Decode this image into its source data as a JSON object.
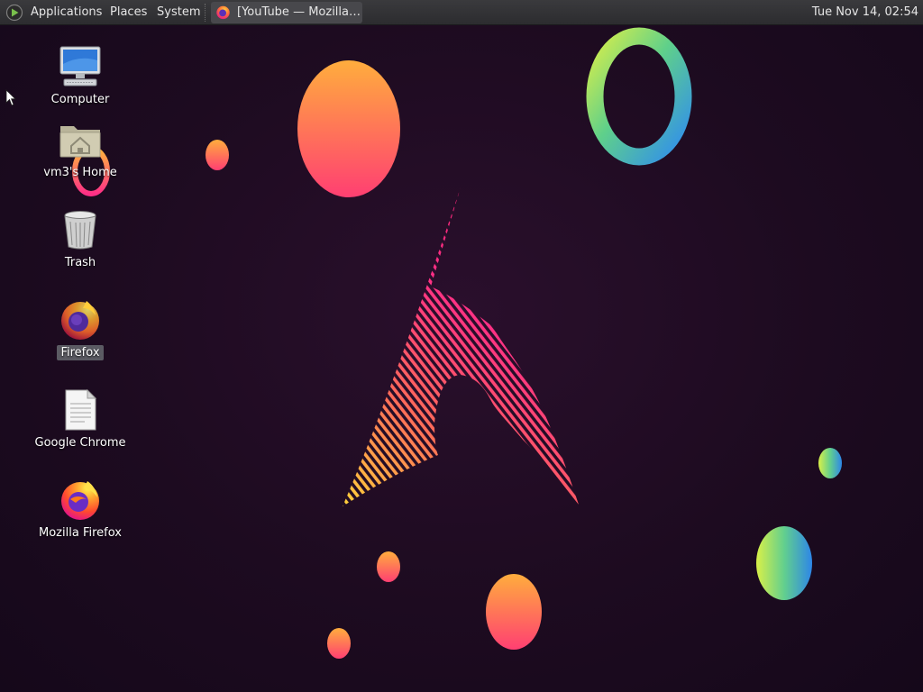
{
  "panel": {
    "menus": [
      {
        "label": "Applications"
      },
      {
        "label": "Places"
      },
      {
        "label": "System"
      }
    ],
    "task": {
      "label": "[YouTube — Mozilla…",
      "icon": "firefox-icon"
    },
    "clock": "Tue Nov 14, 02:54"
  },
  "desktop": {
    "icons": [
      {
        "label": "Computer",
        "icon": "computer-icon"
      },
      {
        "label": "vm3's Home",
        "icon": "home-folder-icon"
      },
      {
        "label": "Trash",
        "icon": "trash-icon"
      },
      {
        "label": "Firefox",
        "icon": "firefox-icon",
        "selected": true
      },
      {
        "label": "Google Chrome",
        "icon": "text-file-icon"
      },
      {
        "label": "Mozilla Firefox",
        "icon": "firefox-icon"
      }
    ]
  },
  "colors": {
    "panel_bg": "#2f2f32",
    "wallpaper_bg": "#1d0b20",
    "accent_pink": "#ff2f86",
    "accent_orange": "#ff8a3d"
  }
}
